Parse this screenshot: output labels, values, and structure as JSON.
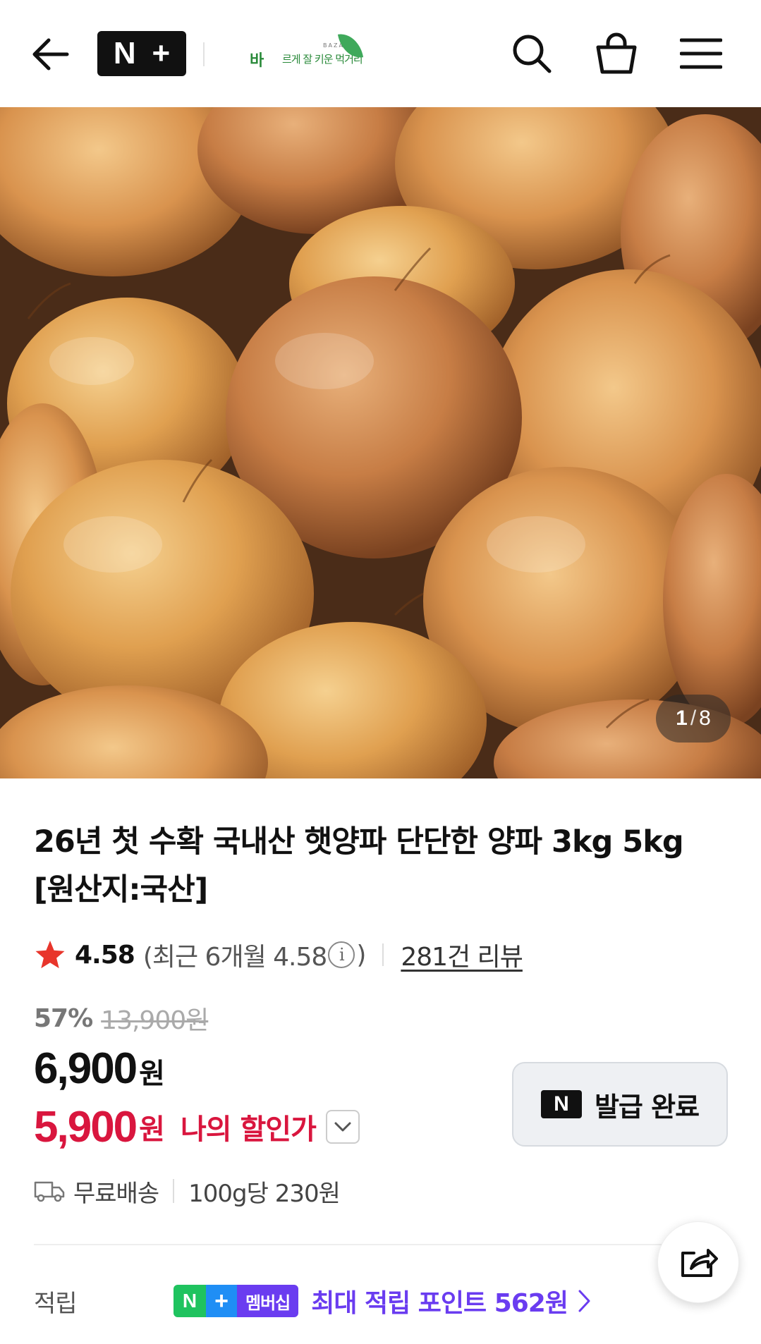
{
  "header": {
    "back_icon": "arrow-left-icon",
    "brand_logo": {
      "n": "N",
      "plus": "+"
    },
    "store_logo": {
      "main": "바",
      "sub": "르게 잘 키운 먹거리",
      "bazar": "BAZAR",
      "leaf_color": "#3fa95b"
    },
    "icons": [
      "search-icon",
      "shopping-bag-icon",
      "hamburger-menu-icon"
    ]
  },
  "gallery": {
    "current": "1",
    "separator": "/",
    "total": "8",
    "image_subject": "onions"
  },
  "product": {
    "title": "26년 첫 수확 국내산 햇양파 단단한 양파 3kg 5kg [원산지:국산]",
    "rating": "4.58",
    "recent_rating_prefix": "(최근 6개월 4.58",
    "recent_rating_suffix": ")",
    "info_glyph": "i",
    "review_link": "281건 리뷰",
    "discount_rate": "57%",
    "original_price": "13,900원",
    "price": "6,900",
    "price_unit": "원",
    "my_price": "5,900",
    "my_price_unit": "원",
    "my_price_label": "나의 할인가",
    "coupon": {
      "n": "N",
      "label": "발급 완료"
    },
    "shipping": "무료배송",
    "unit_price": "100g당 230원"
  },
  "points": {
    "label": "적립",
    "badge": {
      "n": "N",
      "plus": "+",
      "text": "멤버십"
    },
    "text": "최대 적립 포인트 562원"
  },
  "colors": {
    "accent_red": "#d9163e",
    "membership_purple": "#6a3cf0",
    "membership_green": "#1fc35f",
    "membership_blue": "#1f8ef5",
    "star": "#e8352b"
  }
}
